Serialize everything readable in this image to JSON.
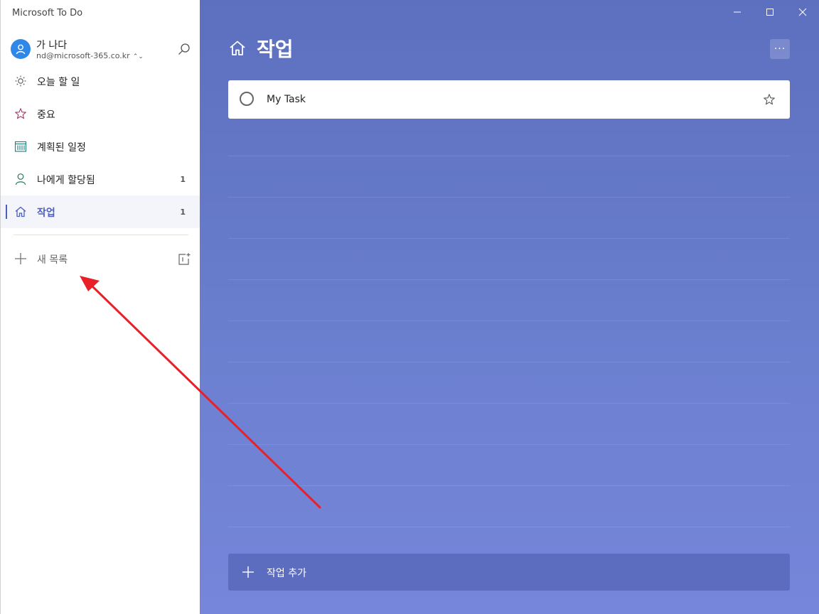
{
  "app": {
    "title": "Microsoft To Do"
  },
  "account": {
    "name": "가 나다",
    "email": "nd@microsoft-365.co.kr"
  },
  "sidebar": {
    "items": [
      {
        "label": "오늘 할 일",
        "icon": "sun-icon",
        "count": ""
      },
      {
        "label": "중요",
        "icon": "star-icon",
        "count": ""
      },
      {
        "label": "계획된 일정",
        "icon": "calendar-icon",
        "count": ""
      },
      {
        "label": "나에게 할당됨",
        "icon": "person-icon",
        "count": "1"
      },
      {
        "label": "작업",
        "icon": "home-icon",
        "count": "1",
        "active": true
      }
    ],
    "new_list_label": "새 목록"
  },
  "main": {
    "title": "작업",
    "more_label": "···",
    "tasks": [
      {
        "title": "My Task"
      }
    ],
    "add_task_label": "작업 추가"
  },
  "colors": {
    "accent": "#4c5fbf",
    "main_bg_top": "#5d6fbf",
    "main_bg_bottom": "#7686da",
    "arrow": "#e8202a",
    "avatar": "#2f88e8"
  }
}
